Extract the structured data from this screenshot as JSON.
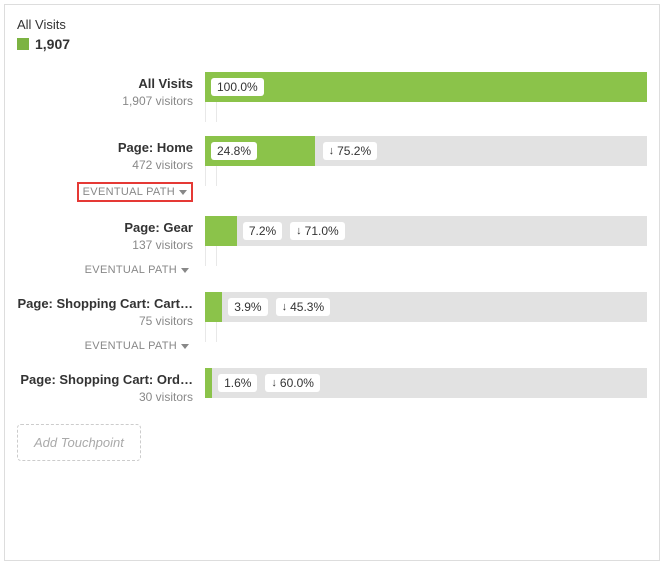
{
  "header": {
    "title": "All Visits",
    "count": "1,907"
  },
  "rows": [
    {
      "label": "All Visits",
      "sub": "1,907 visitors",
      "pct": "100.0%",
      "width": 100,
      "drop": null,
      "path": null,
      "connector": true
    },
    {
      "label": "Page: Home",
      "sub": "472 visitors",
      "pct": "24.8%",
      "width": 24.8,
      "drop": "75.2%",
      "path": "EVENTUAL PATH",
      "highlight": true,
      "connector": true
    },
    {
      "label": "Page: Gear",
      "sub": "137 visitors",
      "pct": "7.2%",
      "width": 7.2,
      "drop": "71.0%",
      "path": "EVENTUAL PATH",
      "connector": true
    },
    {
      "label": "Page: Shopping Cart: Cart…",
      "sub": "75 visitors",
      "pct": "3.9%",
      "width": 3.9,
      "drop": "45.3%",
      "path": "EVENTUAL PATH",
      "connector": true
    },
    {
      "label": "Page: Shopping Cart: Ord…",
      "sub": "30 visitors",
      "pct": "1.6%",
      "width": 1.6,
      "drop": "60.0%",
      "path": null,
      "connector": false
    }
  ],
  "addTouchpoint": "Add Touchpoint",
  "chart_data": {
    "type": "bar",
    "title": "All Visits",
    "total": 1907,
    "categories": [
      "All Visits",
      "Page: Home",
      "Page: Gear",
      "Page: Shopping Cart: Cart…",
      "Page: Shopping Cart: Ord…"
    ],
    "series": [
      {
        "name": "visitors",
        "values": [
          1907,
          472,
          137,
          75,
          30
        ]
      },
      {
        "name": "pct_of_total",
        "values": [
          100.0,
          24.8,
          7.2,
          3.9,
          1.6
        ]
      },
      {
        "name": "dropoff_pct",
        "values": [
          null,
          75.2,
          71.0,
          45.3,
          60.0
        ]
      }
    ],
    "xlabel": "",
    "ylabel": "",
    "xlim": [
      0,
      100
    ]
  }
}
